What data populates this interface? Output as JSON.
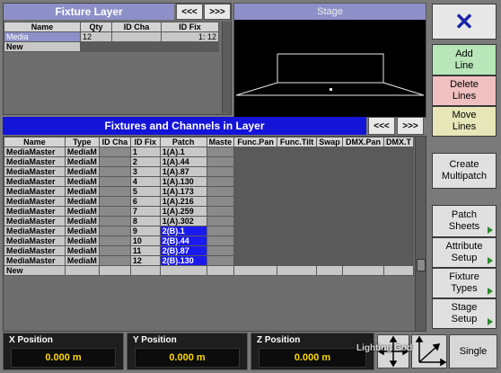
{
  "fixture_layer": {
    "title": "Fixture Layer",
    "nav_prev": "<<<",
    "nav_next": ">>>",
    "columns": [
      "Name",
      "Qty",
      "ID Cha",
      "ID Fix"
    ],
    "rows": [
      {
        "name": "Media",
        "qty": "12",
        "idcha": "",
        "idfix": "1:  12"
      },
      {
        "name": "New",
        "qty": "",
        "idcha": "",
        "idfix": ""
      }
    ]
  },
  "stage": {
    "title": "Stage"
  },
  "buttons": {
    "close": "✕",
    "add_line": "Add\nLine",
    "delete_lines": "Delete\nLines",
    "move_lines": "Move\nLines",
    "create_multipatch": "Create\nMultipatch",
    "patch_sheets": "Patch\nSheets",
    "attribute_setup": "Attribute\nSetup",
    "fixture_types": "Fixture\nTypes",
    "stage_setup": "Stage\nSetup"
  },
  "fixtures_channels": {
    "title": "Fixtures and Channels in Layer",
    "nav_prev": "<<<",
    "nav_next": ">>>",
    "columns": [
      "Name",
      "Type",
      "ID Cha",
      "ID Fix",
      "Patch",
      "Maste",
      "Func.Pan",
      "Func.Tilt",
      "Swap",
      "DMX.Pan",
      "DMX.T"
    ],
    "rows": [
      {
        "name": "MediaMaster",
        "type": "MediaM",
        "idfix": "1",
        "patch": "1(A).1",
        "sel": false
      },
      {
        "name": "MediaMaster",
        "type": "MediaM",
        "idfix": "2",
        "patch": "1(A).44",
        "sel": false
      },
      {
        "name": "MediaMaster",
        "type": "MediaM",
        "idfix": "3",
        "patch": "1(A).87",
        "sel": false
      },
      {
        "name": "MediaMaster",
        "type": "MediaM",
        "idfix": "4",
        "patch": "1(A).130",
        "sel": false
      },
      {
        "name": "MediaMaster",
        "type": "MediaM",
        "idfix": "5",
        "patch": "1(A).173",
        "sel": false
      },
      {
        "name": "MediaMaster",
        "type": "MediaM",
        "idfix": "6",
        "patch": "1(A).216",
        "sel": false
      },
      {
        "name": "MediaMaster",
        "type": "MediaM",
        "idfix": "7",
        "patch": "1(A).259",
        "sel": false
      },
      {
        "name": "MediaMaster",
        "type": "MediaM",
        "idfix": "8",
        "patch": "1(A).302",
        "sel": false
      },
      {
        "name": "MediaMaster",
        "type": "MediaM",
        "idfix": "9",
        "patch": "2(B).1",
        "sel": true
      },
      {
        "name": "MediaMaster",
        "type": "MediaM",
        "idfix": "10",
        "patch": "2(B).44",
        "sel": true
      },
      {
        "name": "MediaMaster",
        "type": "MediaM",
        "idfix": "11",
        "patch": "2(B).87",
        "sel": true
      },
      {
        "name": "MediaMaster",
        "type": "MediaM",
        "idfix": "12",
        "patch": "2(B).130",
        "sel": true
      }
    ],
    "new_row": "New"
  },
  "positions": {
    "x_label": "X Position",
    "x_value": "0.000  m",
    "y_label": "Y Position",
    "y_value": "0.000  m",
    "z_label": "Z Position",
    "z_value": "0.000  m"
  },
  "single_button": "Single",
  "watermark": "Lighting God"
}
